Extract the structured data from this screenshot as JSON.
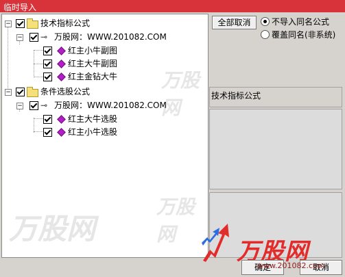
{
  "window": {
    "title": "临时导入"
  },
  "tree": {
    "groups": [
      {
        "label": "技术指标公式",
        "site": "万股网：WWW.201082.COM",
        "items": [
          "红主小牛副图",
          "红主大牛副图",
          "红主金钻大牛"
        ]
      },
      {
        "label": "条件选股公式",
        "site": "万股网：WWW.201082.COM",
        "items": [
          "红主大牛选股",
          "红主小牛选股"
        ]
      }
    ]
  },
  "right": {
    "cancel_all": "全部取消",
    "radio_skip": "不导入同名公式",
    "radio_overwrite": "覆盖同名(非系统)",
    "detail_title": "技术指标公式"
  },
  "buttons": {
    "ok": "确定",
    "cancel": "取消"
  },
  "watermark": {
    "brand": "万股网",
    "url": "www.201082.com"
  },
  "colors": {
    "titlebar": "#d8333a",
    "gem": "#b21fc6",
    "brand": "#e22b2b"
  }
}
